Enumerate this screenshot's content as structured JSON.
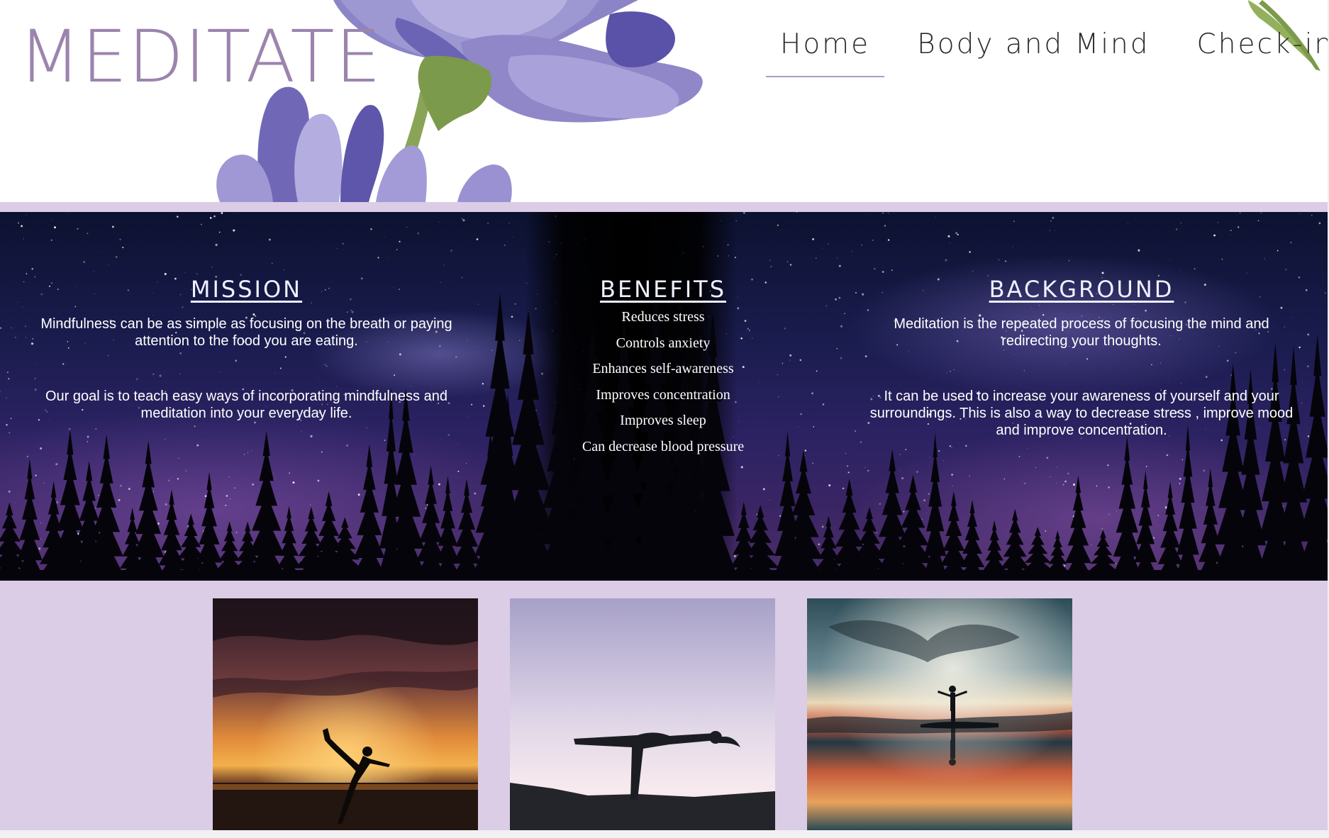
{
  "header": {
    "logo_text": "MEDITATE",
    "nav": [
      {
        "label": "Home",
        "active": true
      },
      {
        "label": "Body and Mind",
        "active": false
      },
      {
        "label": "Check-in",
        "active": false
      }
    ]
  },
  "sections": {
    "mission": {
      "heading": "MISSION",
      "paragraphs": [
        "Mindfulness can be as simple as focusing on the breath or paying attention to the food you are eating.",
        "Our goal is to teach easy ways of incorporating mindfulness and meditation into your everyday life."
      ]
    },
    "benefits": {
      "heading": "BENEFITS",
      "items": [
        "Reduces stress",
        "Controls anxiety",
        "Enhances self-awareness",
        "Improves concentration",
        "Improves sleep",
        "Can decrease blood pressure"
      ]
    },
    "background": {
      "heading": "BACKGROUND",
      "paragraphs": [
        "Meditation is the repeated process of focusing the mind and redirecting your thoughts.",
        "It can be used to increase your awareness of yourself and your surroundings. This is also a way to decrease stress , improve mood and improve concentration."
      ]
    }
  },
  "colors": {
    "logo": "#9b84ad",
    "lavender_band": "#dbcde6",
    "nav_active_underline": "#a99ad0",
    "flower_purple": "#8e86c7",
    "stem_green": "#7c9a4b"
  },
  "photos": [
    {
      "icon": "yoga-dancer-pose-sunset-photo"
    },
    {
      "icon": "yoga-warrior-three-pose-dusk-photo"
    },
    {
      "icon": "person-arms-outstretched-reflection-photo"
    }
  ]
}
